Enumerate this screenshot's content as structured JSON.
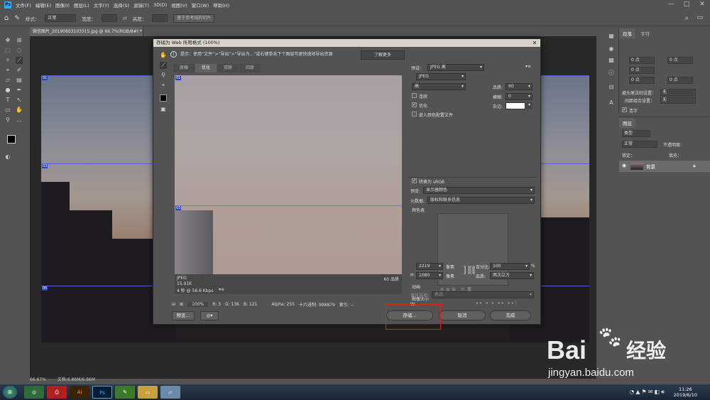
{
  "menubar": {
    "app_logo": "Ps",
    "items": [
      "文件(F)",
      "编辑(E)",
      "图像(I)",
      "图层(L)",
      "文字(Y)",
      "选择(S)",
      "滤镜(T)",
      "3D(D)",
      "视图(V)",
      "窗口(W)",
      "帮助(H)"
    ],
    "minimize": "—",
    "maximize": "□",
    "close": "✕"
  },
  "options_bar": {
    "style_label": "样式：",
    "style_value": "正常",
    "width_label": "宽度：",
    "height_label": "高度：",
    "guides_button": "基于参考线的切片"
  },
  "document": {
    "tab_title": "微信图片_20190603103315.jpg @ 66.7%(RGB/8#) *",
    "slice_tags": [
      "01",
      "03",
      "05"
    ],
    "status_zoom": "66.67%",
    "status_doc": "文档:6.86M/6.86M"
  },
  "right_panel": {
    "tabs": [
      "段落",
      "字符"
    ],
    "pt_values": [
      "0 点",
      "0 点",
      "0 点",
      "0 点",
      "0 点"
    ],
    "avoid_label": "避头尾法则设置：",
    "avoid_value": "无",
    "spacing_label": "间距组合设置：",
    "spacing_value": "无",
    "hyphen_label": "连字",
    "layers_tab": "图层",
    "kind_value": "类型",
    "blend_value": "正常",
    "opacity_label": "不透明度：",
    "lock_label": "锁定：",
    "fill_label": "填充：",
    "layer_name": "背景"
  },
  "dialog": {
    "title": "存储为 Web 所用格式 (100%)",
    "close": "✕",
    "tip": "提示：使用“文件”>“导出”>“导出为...”或右键单击下个图层可更快速地导出资源",
    "learn_more": "了解更多",
    "view_tabs": [
      "原稿",
      "优化",
      "双联",
      "四联"
    ],
    "preview_slice_tag": "03",
    "preview_info": {
      "format": "JPEG",
      "size": "15.91K",
      "time": "4 秒 @ 56.6 Kbps",
      "quality": "60 品质"
    },
    "bottom_bar": {
      "zoom": "100%",
      "r": "R: 3",
      "g": "G: 136",
      "b": "B: 121",
      "alpha": "Alpha: 255",
      "hex": "十六进制: 998879",
      "index": "索引: --"
    },
    "preview_button": "预览...",
    "settings": {
      "preset_label": "预设:",
      "preset_value": "JPEG 高",
      "format_value": "JPEG",
      "quality_level": "高",
      "quality_label": "品质:",
      "quality_value": "60",
      "progressive_label": "连续",
      "blur_label": "模糊:",
      "blur_value": "0",
      "optimized_label": "优化",
      "matte_label": "杂边:",
      "embed_profile_label": "嵌入颜色配置文件",
      "convert_srgb_label": "转换为 sRGB",
      "preview_label": "预览:",
      "preview_value": "显示器颜色",
      "metadata_label": "元数据:",
      "metadata_value": "版权和联系信息",
      "color_table_label": "颜色表",
      "image_size_label": "图像大小",
      "width_label": "W:",
      "width_value": "2219",
      "height_label": "H:",
      "height_value": "1080",
      "unit": "像素",
      "percent_label": "百分比:",
      "percent_value": "100",
      "percent_unit": "%",
      "resample_label": "品质:",
      "resample_value": "两次立方",
      "animation_label": "动画",
      "loop_label": "循环选项:",
      "loop_value": "永远"
    },
    "save_button": "存储...",
    "cancel_button": "取消",
    "done_button": "完成"
  },
  "taskbar": {
    "time": "11:26",
    "date": "2019/6/10"
  },
  "watermark": {
    "brand": "Bai",
    "brand_cn": "经验",
    "url": "jingyan.baidu.com"
  },
  "colors": {
    "accent": "#2342d6",
    "highlight_box": "#e02020",
    "ps_blue": "#31a8ff"
  }
}
